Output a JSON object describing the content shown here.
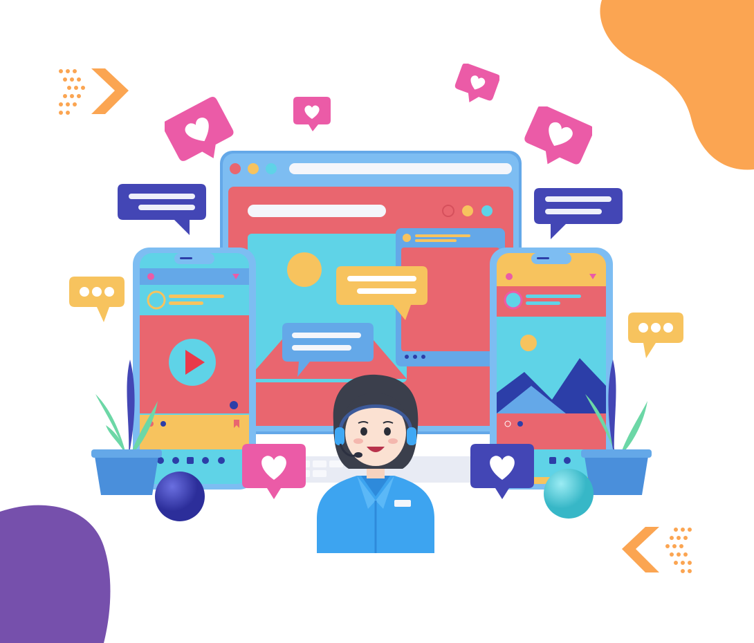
{
  "colors": {
    "orange": "#FBA552",
    "purple": "#7650AC",
    "monitor_blue": "#64A8E8",
    "screen_pink": "#E9666F",
    "cyan": "#5FD3E7",
    "yellow": "#F7C35E",
    "navy": "#4346B5",
    "heart_pink": "#EB5BA7",
    "plant_green": "#6CD7A6",
    "pot_blue": "#4A8FDB",
    "shirt_blue": "#3DA4F0",
    "hair": "#3B3F4C"
  },
  "scene": {
    "subject": "customer-support-agent-with-headset",
    "devices": [
      "desktop-monitor",
      "left-phone",
      "right-phone",
      "keyboard"
    ],
    "icons": [
      "heart-icon",
      "chat-bubble-icon",
      "typing-dots-icon",
      "play-icon",
      "arrow-chevron-icon"
    ]
  }
}
